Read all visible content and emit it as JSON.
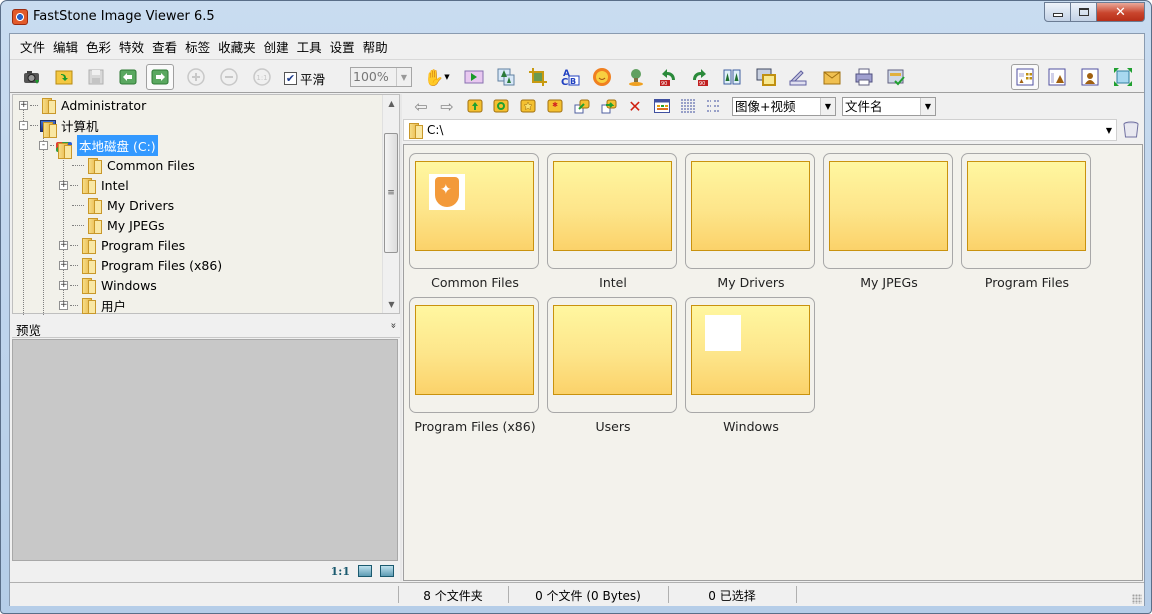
{
  "window": {
    "title": "FastStone Image Viewer 6.5",
    "controls": {
      "minimize": "▭",
      "maximize": "□",
      "close": "✕"
    }
  },
  "menu": [
    "文件",
    "编辑",
    "色彩",
    "特效",
    "查看",
    "标签",
    "收藏夹",
    "创建",
    "工具",
    "设置",
    "帮助"
  ],
  "toolbar": {
    "buttons": [
      {
        "name": "screen-capture-icon",
        "enabled": true
      },
      {
        "name": "open-folder-icon",
        "enabled": true
      },
      {
        "name": "save-icon",
        "enabled": false
      },
      {
        "name": "previous-icon",
        "enabled": true
      },
      {
        "name": "next-icon",
        "enabled": true,
        "pressed": true
      },
      {
        "name": "zoom-in-icon",
        "enabled": false
      },
      {
        "name": "zoom-out-icon",
        "enabled": false
      },
      {
        "name": "actual-size-icon",
        "enabled": false
      }
    ],
    "smooth_label": "平滑",
    "smooth_checked": true,
    "zoom_value": "100%",
    "tools": [
      "hand-tool-icon",
      "slideshow-icon",
      "resize-icon",
      "crop-icon",
      "text-icon",
      "color-adjust-icon",
      "stamp-icon",
      "rotate-left-icon",
      "rotate-right-icon",
      "compare-icon",
      "wallpaper-icon",
      "scanner-icon",
      "email-icon",
      "print-icon",
      "batch-icon"
    ],
    "layouts": [
      "browser-layout-icon",
      "browser-preview-layout-icon",
      "preview-layout-icon",
      "fullscreen-icon"
    ]
  },
  "tree": {
    "items": [
      {
        "label": "Administrator",
        "level": 0,
        "expander": "+"
      },
      {
        "label": "计算机",
        "level": 0,
        "expander": "-"
      },
      {
        "label": "本地磁盘 (C:)",
        "level": 1,
        "expander": "-",
        "selected": true
      },
      {
        "label": "Common Files",
        "level": 2,
        "expander": ""
      },
      {
        "label": "Intel",
        "level": 2,
        "expander": "+"
      },
      {
        "label": "My Drivers",
        "level": 2,
        "expander": ""
      },
      {
        "label": "My JPEGs",
        "level": 2,
        "expander": ""
      },
      {
        "label": "Program Files",
        "level": 2,
        "expander": "+"
      },
      {
        "label": "Program Files (x86)",
        "level": 2,
        "expander": "+"
      },
      {
        "label": "Windows",
        "level": 2,
        "expander": "+"
      },
      {
        "label": "用户",
        "level": 2,
        "expander": "+"
      }
    ]
  },
  "preview": {
    "title": "预览",
    "collapse_glyph": "»",
    "actual_size_label": "1:1"
  },
  "browser": {
    "filter_value": "图像+视频",
    "sort_value": "文件名",
    "path": "C:\\",
    "thumbnails": [
      {
        "label": "Common Files",
        "overlay": "shield"
      },
      {
        "label": "Intel",
        "overlay": ""
      },
      {
        "label": "My Drivers",
        "overlay": ""
      },
      {
        "label": "My JPEGs",
        "overlay": ""
      },
      {
        "label": "Program Files",
        "overlay": ""
      },
      {
        "label": "Program Files (x86)",
        "overlay": ""
      },
      {
        "label": "Users",
        "overlay": ""
      },
      {
        "label": "Windows",
        "overlay": "white"
      }
    ]
  },
  "status": {
    "folders": "8 个文件夹",
    "files": "0 个文件 (0 Bytes)",
    "selected": "0 已选择"
  }
}
